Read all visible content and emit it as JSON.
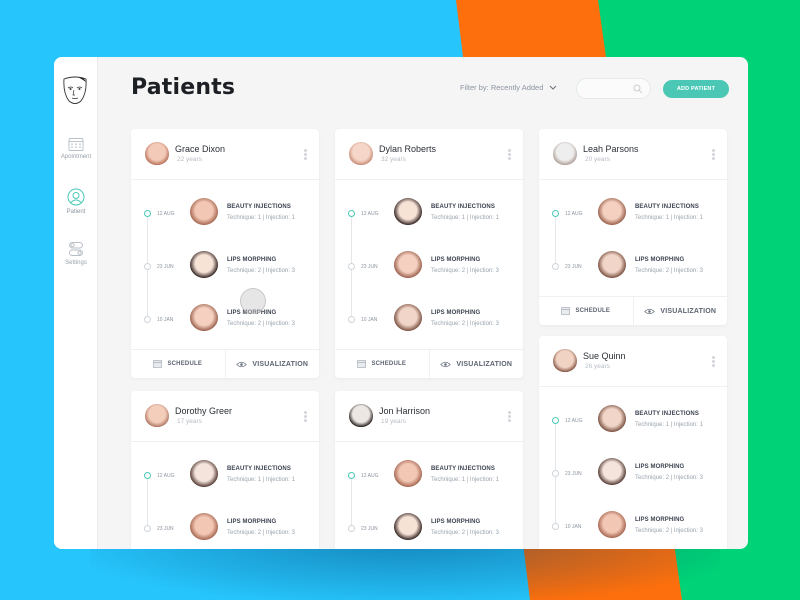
{
  "app": {
    "page_title": "Patients",
    "logo_icon": "face-mask-icon"
  },
  "sidebar": {
    "items": [
      {
        "label": "Apointment",
        "icon": "calendar-icon",
        "active": false
      },
      {
        "label": "Patient",
        "icon": "user-circle-icon",
        "active": true
      },
      {
        "label": "Settings",
        "icon": "toggle-icon",
        "active": false
      }
    ]
  },
  "toolbar": {
    "filter_label": "Filter by: Recently Added",
    "search_placeholder": "",
    "add_button": "ADD PATIENT"
  },
  "colors": {
    "accent": "#4ac8b5",
    "background_blue": "#26c6fd",
    "background_orange": "#fd6f0c",
    "background_green": "#00d277"
  },
  "card_actions": {
    "schedule": "SCHEDULE",
    "visualization": "VISUALIZATION"
  },
  "patients": [
    {
      "name": "Grace Dixon",
      "age": "22 years",
      "treatments": [
        {
          "date": "12 AUG",
          "procedure": "BEAUTY INJECTIONS",
          "meta": "Technique: 1  |  Injection: 1",
          "active": true
        },
        {
          "date": "23 JUN",
          "procedure": "LIPS MORPHING",
          "meta": "Technique: 2  |  Injection: 3",
          "active": false
        },
        {
          "date": "10 JAN",
          "procedure": "LIPS MORPHING",
          "meta": "Technique: 2  |  Injection: 3",
          "active": false
        }
      ]
    },
    {
      "name": "Dylan Roberts",
      "age": "32 years",
      "treatments": [
        {
          "date": "12 AUG",
          "procedure": "BEAUTY INJECTIONS",
          "meta": "Technique: 1  |  Injection: 1",
          "active": true
        },
        {
          "date": "23 JUN",
          "procedure": "LIPS MORPHING",
          "meta": "Technique: 2  |  Injection: 3",
          "active": false
        },
        {
          "date": "10 JAN",
          "procedure": "LIPS MORPHING",
          "meta": "Technique: 2  |  Injection: 3",
          "active": false
        }
      ]
    },
    {
      "name": "Leah Parsons",
      "age": "20 years",
      "treatments": [
        {
          "date": "12 AUG",
          "procedure": "BEAUTY INJECTIONS",
          "meta": "Technique: 1  |  Injection: 1",
          "active": true
        },
        {
          "date": "23 JUN",
          "procedure": "LIPS MORPHING",
          "meta": "Technique: 2  |  Injection: 3",
          "active": false
        }
      ]
    },
    {
      "name": "Sue Quinn",
      "age": "26 years",
      "treatments": [
        {
          "date": "12 AUG",
          "procedure": "BEAUTY INJECTIONS",
          "meta": "Technique: 1  |  Injection: 1",
          "active": true
        },
        {
          "date": "23 JUN",
          "procedure": "LIPS MORPHING",
          "meta": "Technique: 2  |  Injection: 3",
          "active": false
        },
        {
          "date": "10 JAN",
          "procedure": "LIPS MORPHING",
          "meta": "Technique: 2  |  Injection: 3",
          "active": false
        }
      ]
    },
    {
      "name": "Dorothy Greer",
      "age": "17 years",
      "treatments": [
        {
          "date": "12 AUG",
          "procedure": "BEAUTY INJECTIONS",
          "meta": "Technique: 1  |  Injection: 1",
          "active": true
        },
        {
          "date": "23 JUN",
          "procedure": "LIPS MORPHING",
          "meta": "Technique: 2  |  Injection: 3",
          "active": false
        }
      ]
    },
    {
      "name": "Jon Harrison",
      "age": "19 years",
      "treatments": [
        {
          "date": "12 AUG",
          "procedure": "BEAUTY INJECTIONS",
          "meta": "Technique: 1  |  Injection: 1",
          "active": true
        },
        {
          "date": "23 JUN",
          "procedure": "LIPS MORPHING",
          "meta": "Technique: 2  |  Injection: 3",
          "active": false
        }
      ]
    }
  ]
}
